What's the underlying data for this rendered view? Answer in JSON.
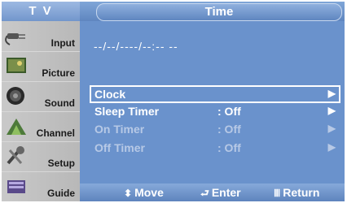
{
  "tab": {
    "label": "T V"
  },
  "header": {
    "title": "Time"
  },
  "sidebar": {
    "items": [
      {
        "label": "Input"
      },
      {
        "label": "Picture"
      },
      {
        "label": "Sound"
      },
      {
        "label": "Channel"
      },
      {
        "label": "Setup"
      },
      {
        "label": "Guide"
      }
    ]
  },
  "clock_display": "--/--/----/--:-- --",
  "menu": {
    "items": [
      {
        "label": "Clock",
        "value": "",
        "arrow": "▶"
      },
      {
        "label": "Sleep Timer",
        "value": ": Off",
        "arrow": "▶"
      },
      {
        "label": "On Timer",
        "value": ": Off",
        "arrow": "▶"
      },
      {
        "label": "Off Timer",
        "value": ": Off",
        "arrow": "▶"
      }
    ]
  },
  "footer": {
    "move_glyph": "⬍",
    "move": "Move",
    "enter_glyph": "⮐",
    "enter": "Enter",
    "return_glyph": "Ⅲ",
    "return": "Return"
  },
  "colors": {
    "panel": "#6a92cc",
    "sidebar": "#c4c4c4",
    "dim_text": "#b7c9e6"
  }
}
